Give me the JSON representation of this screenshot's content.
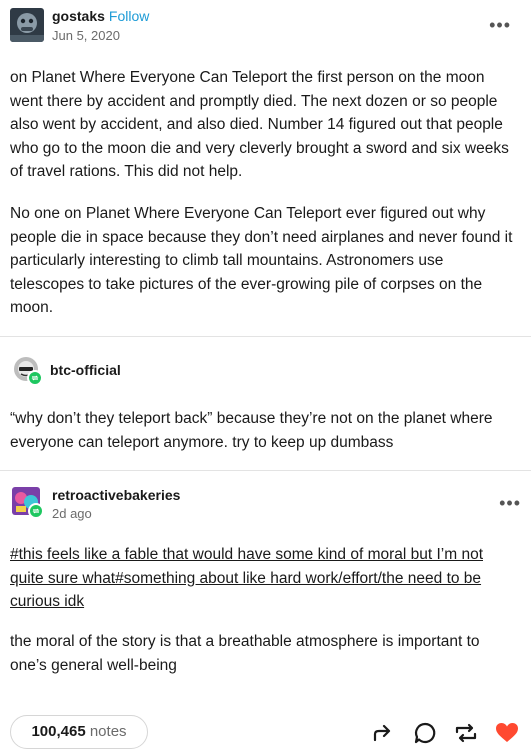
{
  "post": {
    "author": "gostaks",
    "follow_label": "Follow",
    "date": "Jun 5, 2020",
    "more_icon": "ellipsis-icon",
    "paragraphs": [
      "on Planet Where Everyone Can Teleport the first person on the moon went there by accident and promptly died. The next dozen or so people also went by accident, and also died. Number 14 figured out that people who go to the moon die and very cleverly brought a sword and six weeks of travel rations. This did not help.",
      "No one on Planet Where Everyone Can Teleport ever figured out why people die in space because they don’t need airplanes and never found it particularly interesting to climb tall mountains. Astronomers use telescopes to take pictures of the ever-growing pile of corpses on the moon."
    ]
  },
  "reblogs": [
    {
      "author": "btc-official",
      "text": "“why don’t they teleport back” because they’re not on the planet where everyone can teleport anymore. try to keep up dumbass"
    },
    {
      "author": "retroactivebakeries",
      "date": "2d ago",
      "tags": "#this feels like a fable that would have some kind of moral but I’m not quite sure what#something about like hard work/effort/the need to be curious idk",
      "text": "the moral of the story is that a breathable atmosphere is important to one’s general well-being"
    }
  ],
  "footer": {
    "notes_count": "100,465",
    "notes_label": "notes",
    "icons": [
      "share-icon",
      "reply-icon",
      "reblog-icon",
      "like-icon"
    ]
  },
  "colors": {
    "follow": "#1d9bd6",
    "badge": "#1ec760",
    "like": "#ff4930",
    "divider": "#e3e3e3"
  }
}
